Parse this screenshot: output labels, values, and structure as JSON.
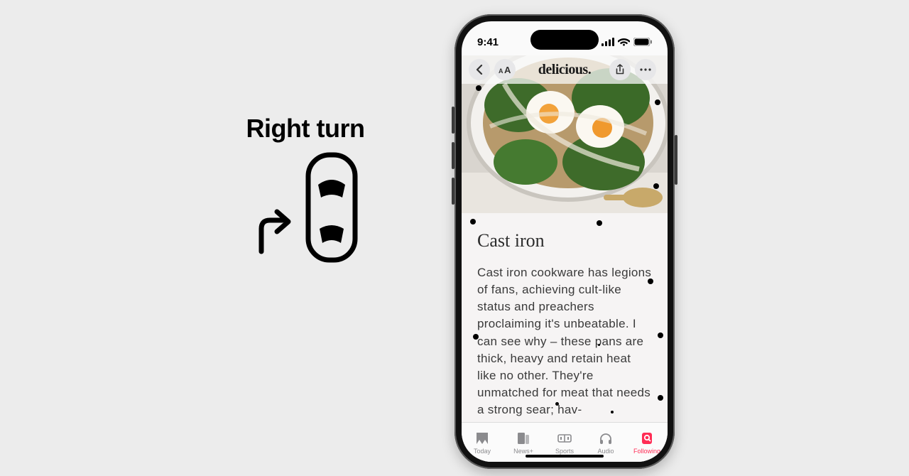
{
  "annotation": {
    "title": "Right turn"
  },
  "status": {
    "time": "9:41"
  },
  "nav": {
    "title": "delicious."
  },
  "article": {
    "heading": "Cast iron",
    "body": "Cast iron cookware has legions of fans, achieving cult-like status and preachers proclaiming it's unbeatable. I can see why – these pans are thick, heavy and retain heat like no other. They're unmatched for meat that needs a strong sear; hav-"
  },
  "tabs": {
    "today": "Today",
    "newsplus": "News+",
    "sports": "Sports",
    "audio": "Audio",
    "following": "Following"
  }
}
